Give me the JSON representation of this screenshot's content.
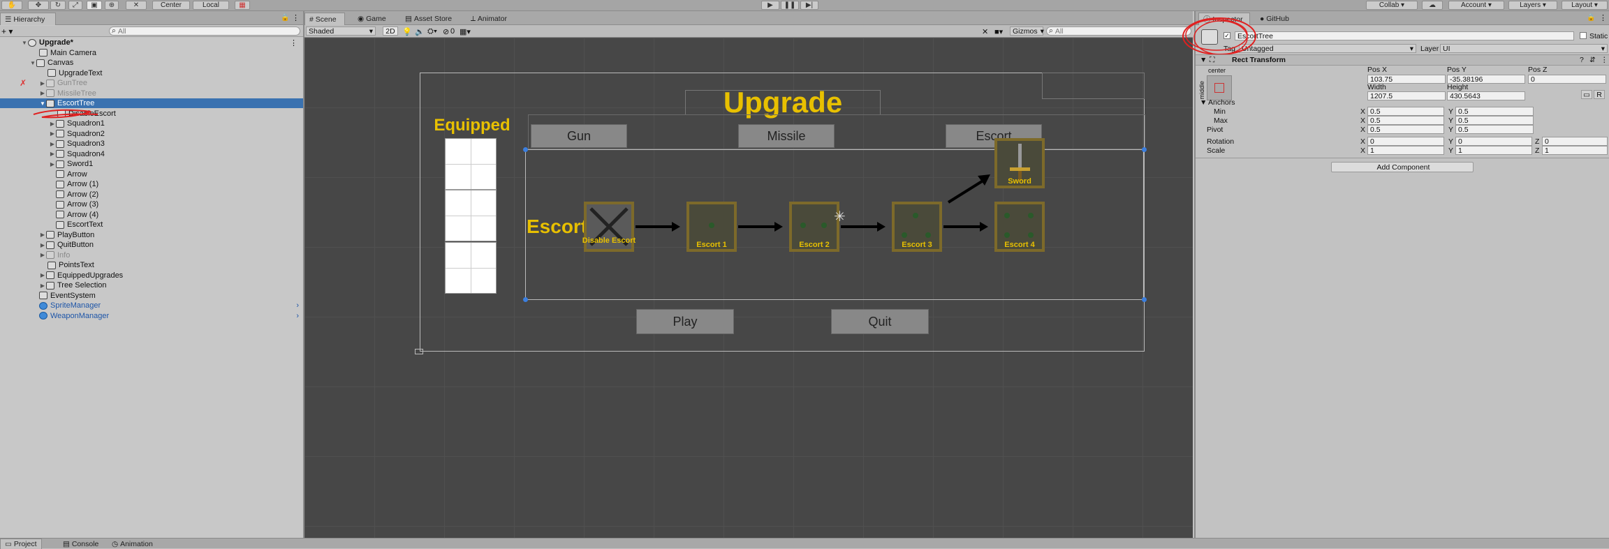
{
  "toolbar": {
    "center": "Center",
    "local": "Local",
    "collab": "Collab",
    "account": "Account",
    "layers": "Layers",
    "layout": "Layout"
  },
  "hierarchy": {
    "tab": "Hierarchy",
    "search_placeholder": "All",
    "items": [
      {
        "label": "Upgrade*"
      },
      {
        "label": "Main Camera"
      },
      {
        "label": "Canvas"
      },
      {
        "label": "UpgradeText"
      },
      {
        "label": "GunTree"
      },
      {
        "label": "MissileTree"
      },
      {
        "label": "EscortTree"
      },
      {
        "label": "DisableEscort"
      },
      {
        "label": "Squadron1"
      },
      {
        "label": "Squadron2"
      },
      {
        "label": "Squadron3"
      },
      {
        "label": "Squadron4"
      },
      {
        "label": "Sword1"
      },
      {
        "label": "Arrow"
      },
      {
        "label": "Arrow (1)"
      },
      {
        "label": "Arrow (2)"
      },
      {
        "label": "Arrow (3)"
      },
      {
        "label": "Arrow (4)"
      },
      {
        "label": "EscortText"
      },
      {
        "label": "PlayButton"
      },
      {
        "label": "QuitButton"
      },
      {
        "label": "Info"
      },
      {
        "label": "PointsText"
      },
      {
        "label": "EquippedUpgrades"
      },
      {
        "label": "Tree Selection"
      },
      {
        "label": "EventSystem"
      },
      {
        "label": "SpriteManager"
      },
      {
        "label": "WeaponManager"
      }
    ]
  },
  "scene": {
    "tabs": [
      "Scene",
      "Game",
      "Asset Store",
      "Animator"
    ],
    "shading": "Shaded",
    "mode_2d": "2D",
    "gizmos": "Gizmos",
    "search_placeholder": "All",
    "fx_count": "0",
    "title": "Upgrade",
    "equipped": "Equipped",
    "tree_buttons": [
      "Gun",
      "Missile",
      "Escort"
    ],
    "escort_label": "Escort",
    "nodes": [
      "Disable Escort",
      "Escort 1",
      "Escort 2",
      "Escort 3",
      "Escort 4",
      "Sword"
    ],
    "play": "Play",
    "quit": "Quit"
  },
  "inspector": {
    "tabs": [
      "Inspector",
      "GitHub"
    ],
    "object_name": "EscortTree",
    "static": "Static",
    "tag_label": "Tag",
    "tag_value": "Untagged",
    "layer_label": "Layer",
    "layer_value": "UI",
    "component": "Rect Transform",
    "anchor_preset_top": "center",
    "anchor_preset_side": "middle",
    "pos_x_label": "Pos X",
    "pos_x": "103.75",
    "pos_y_label": "Pos Y",
    "pos_y": "-35.38196",
    "pos_z_label": "Pos Z",
    "pos_z": "0",
    "width_label": "Width",
    "width": "1207.5",
    "height_label": "Height",
    "height": "430.5643",
    "anchors": "Anchors",
    "min": "Min",
    "min_x": "0.5",
    "min_y": "0.5",
    "max": "Max",
    "max_x": "0.5",
    "max_y": "0.5",
    "pivot": "Pivot",
    "pivot_x": "0.5",
    "pivot_y": "0.5",
    "rotation": "Rotation",
    "rot_x": "0",
    "rot_y": "0",
    "rot_z": "0",
    "scale": "Scale",
    "scale_x": "1",
    "scale_y": "1",
    "scale_z": "1",
    "add_component": "Add Component",
    "r_button": "R"
  },
  "bottom": {
    "tabs": [
      "Project",
      "Console",
      "Animation"
    ]
  }
}
